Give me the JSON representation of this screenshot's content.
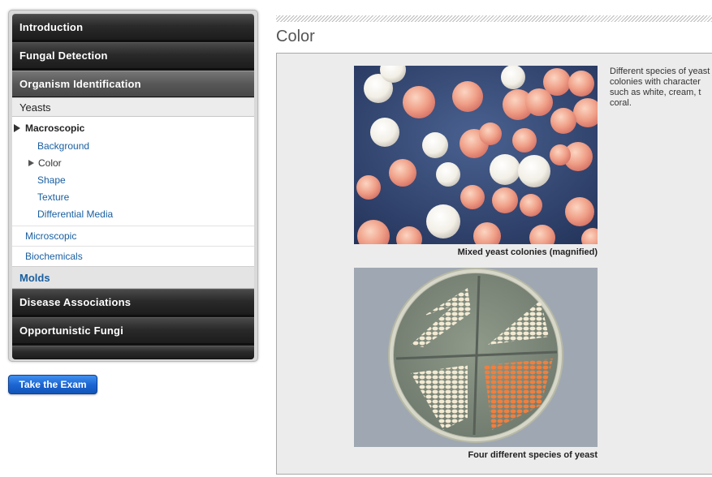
{
  "sidebar": {
    "sections": {
      "introduction": "Introduction",
      "fungal_detection": "Fungal Detection",
      "organism_identification": "Organism Identification",
      "disease_associations": "Disease Associations",
      "opportunistic_fungi": "Opportunistic Fungi"
    },
    "yeasts": {
      "label": "Yeasts",
      "macroscopic": {
        "label": "Macroscopic",
        "items": [
          "Background",
          "Color",
          "Shape",
          "Texture",
          "Differential Media"
        ],
        "current_index": 1
      },
      "microscopic": "Microscopic",
      "biochemicals": "Biochemicals"
    },
    "molds": "Molds"
  },
  "exam_button": "Take the Exam",
  "main": {
    "title": "Color",
    "images": [
      {
        "caption": "Mixed yeast colonies (magnified)"
      },
      {
        "caption": "Four different species of yeast"
      }
    ],
    "description_lines": [
      "Different species of yeast",
      "colonies with character",
      "such as white, cream, t",
      "coral."
    ]
  },
  "colors": {
    "link": "#1a5fa0",
    "button": "#1a63d0",
    "coral_colony": "#f0a58a",
    "white_colony": "#f4f1ea",
    "plate_background": "#30456e"
  }
}
